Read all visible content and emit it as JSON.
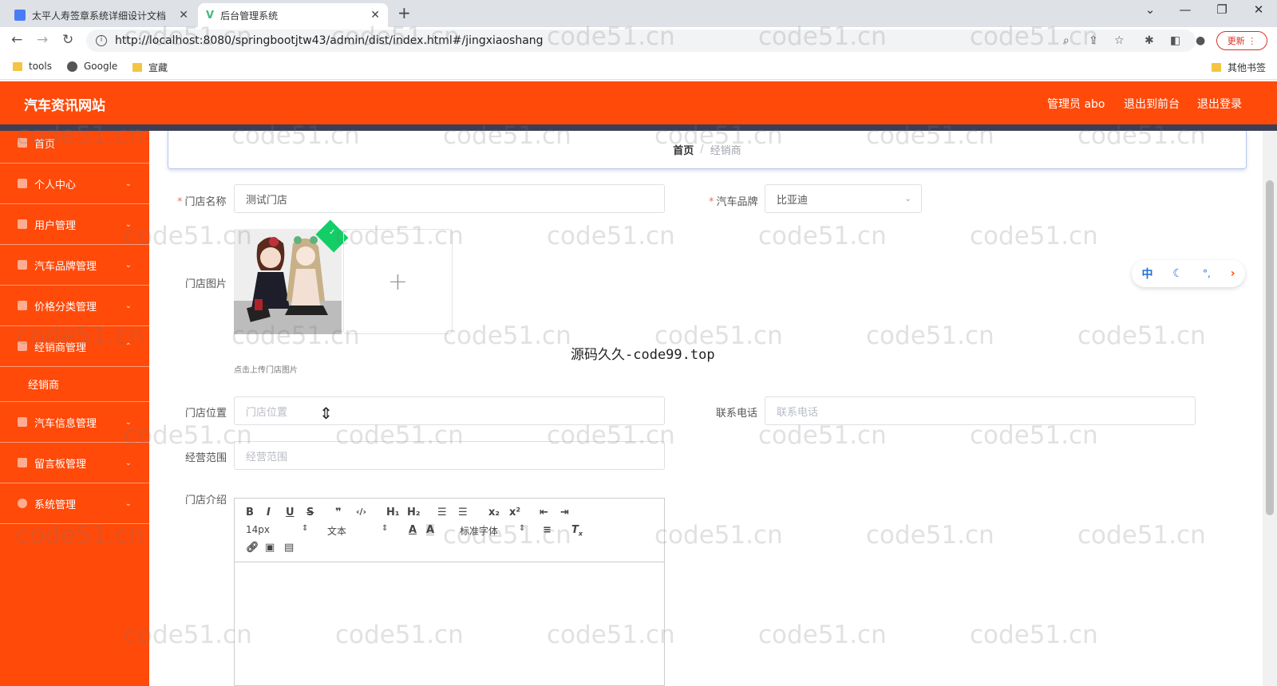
{
  "browser": {
    "tabs": [
      {
        "title": "太平人寿签章系统详细设计文档",
        "active": false
      },
      {
        "title": "后台管理系统",
        "active": true
      }
    ],
    "url": "http://localhost:8080/springbootjtw43/admin/dist/index.html#/jingxiaoshang",
    "update_label": "更新",
    "bookmarks": [
      "tools",
      "Google",
      "宣藏"
    ],
    "other_bookmarks": "其他书签"
  },
  "header": {
    "site_title": "汽车资讯网站",
    "admin_label": "管理员 abo",
    "exit_front": "退出到前台",
    "logout": "退出登录"
  },
  "sidebar": {
    "items": [
      {
        "label": "首页",
        "icon": "home-icon"
      },
      {
        "label": "个人中心",
        "icon": "user-icon"
      },
      {
        "label": "用户管理",
        "icon": "list-icon"
      },
      {
        "label": "汽车品牌管理",
        "icon": "chat-icon"
      },
      {
        "label": "价格分类管理",
        "icon": "user-icon"
      },
      {
        "label": "经销商管理",
        "icon": "bell-icon"
      },
      {
        "label": "汽车信息管理",
        "icon": "chat-icon"
      },
      {
        "label": "留言板管理",
        "icon": "car-icon"
      },
      {
        "label": "系统管理",
        "icon": "gear-icon"
      }
    ],
    "sub_item": "经销商"
  },
  "breadcrumb": {
    "home": "首页",
    "current": "经销商"
  },
  "form": {
    "shop_name_label": "门店名称",
    "shop_name_value": "测试门店",
    "brand_label": "汽车品牌",
    "brand_value": "比亚迪",
    "image_label": "门店图片",
    "upload_tip": "点击上传门店图片",
    "location_label": "门店位置",
    "location_placeholder": "门店位置",
    "phone_label": "联系电话",
    "phone_placeholder": "联系电话",
    "scope_label": "经营范围",
    "scope_placeholder": "经营范围",
    "intro_label": "门店介绍"
  },
  "editor": {
    "font_size": "14px",
    "text_style": "文本",
    "font_family": "标准字体"
  },
  "floating_toolbar": {
    "lang": "中"
  },
  "overlay_text": "源码久久-code99.top",
  "watermark": "code51.cn",
  "colors": {
    "brand": "#ff4a0a",
    "strip": "#3d3f55",
    "required": "#f56c6c"
  }
}
